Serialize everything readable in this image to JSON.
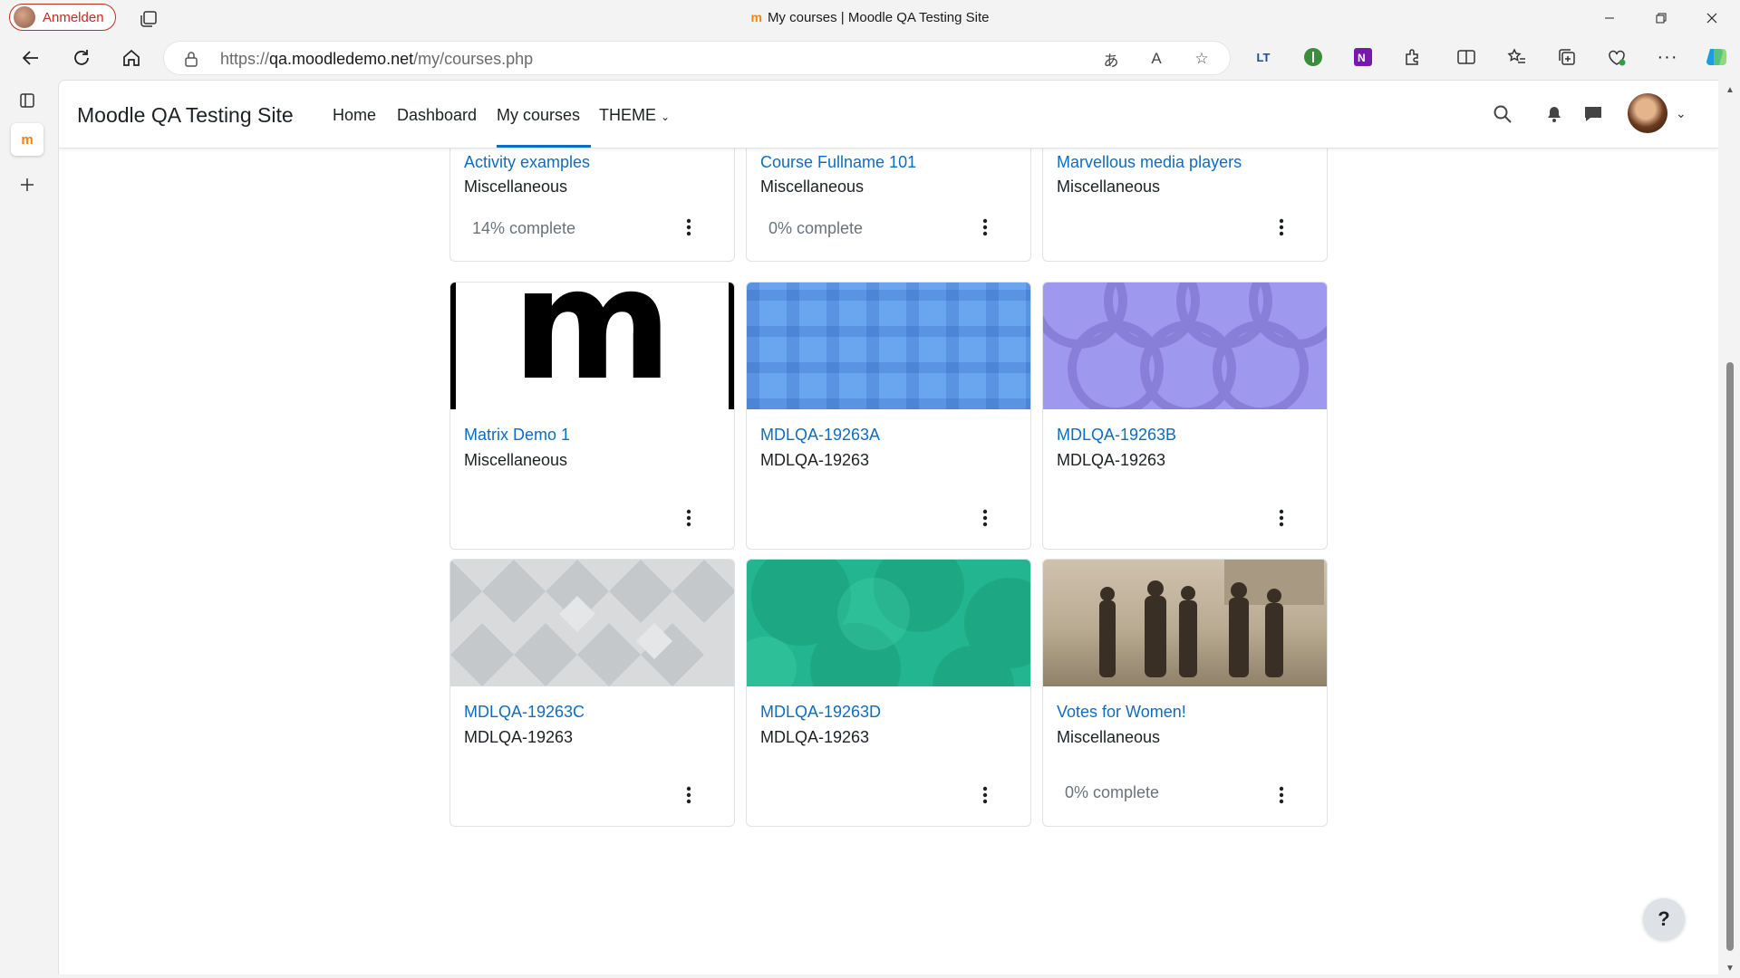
{
  "browser": {
    "profile_label": "Anmelden",
    "window_title": "My courses | Moodle QA Testing Site",
    "favicon": "m",
    "url_prefix": "https://",
    "url_host": "qa.moodledemo.net",
    "url_path": "/my/courses.php",
    "extension_lt_label": "LT"
  },
  "moodle": {
    "site_name": "Moodle QA Testing Site",
    "nav": {
      "home": "Home",
      "dashboard": "Dashboard",
      "my_courses": "My courses",
      "theme": "THEME"
    },
    "help_label": "?"
  },
  "courses": [
    {
      "title": "Activity examples",
      "category": "Miscellaneous",
      "progress": "14% complete"
    },
    {
      "title": "Course Fullname 101",
      "category": "Miscellaneous",
      "progress": "0% complete"
    },
    {
      "title": "Marvellous media players",
      "category": "Miscellaneous",
      "progress": ""
    },
    {
      "title": "Matrix Demo 1",
      "category": "Miscellaneous",
      "progress": "",
      "image_text": "m"
    },
    {
      "title": "MDLQA-19263A",
      "category": "MDLQA-19263",
      "progress": ""
    },
    {
      "title": "MDLQA-19263B",
      "category": "MDLQA-19263",
      "progress": ""
    },
    {
      "title": "MDLQA-19263C",
      "category": "MDLQA-19263",
      "progress": ""
    },
    {
      "title": "MDLQA-19263D",
      "category": "MDLQA-19263",
      "progress": ""
    },
    {
      "title": "Votes for Women!",
      "category": "Miscellaneous",
      "progress": "0% complete"
    }
  ],
  "colors": {
    "link": "#0f6cbf",
    "moodle_orange": "#f98012",
    "profile_red": "#c42b1c",
    "card_blue": "#6aa6f0",
    "card_purple": "#9f98ef",
    "card_grey": "#d8dadc",
    "card_teal": "#22b58f",
    "card_sepia": "#a8977e"
  }
}
